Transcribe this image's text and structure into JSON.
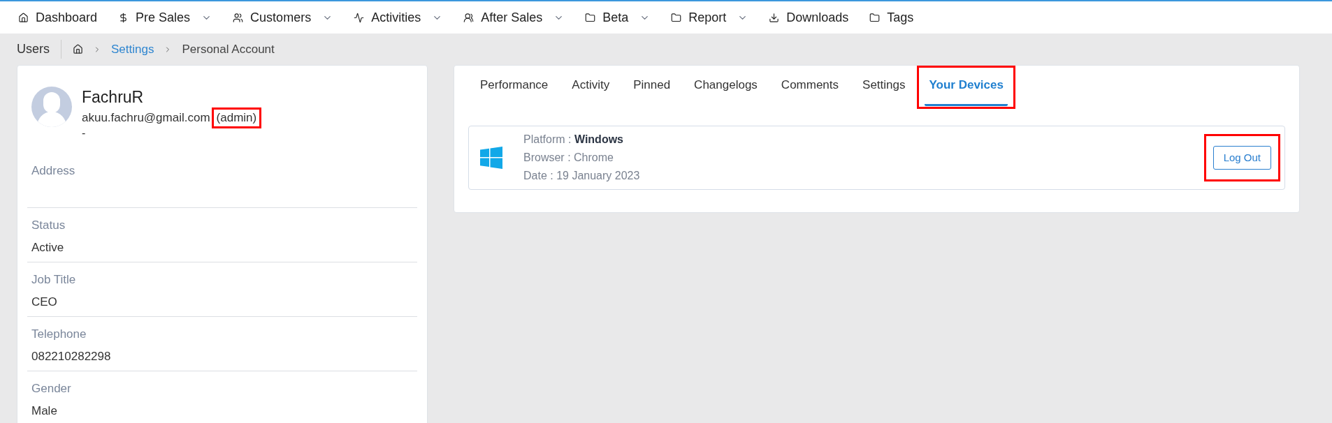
{
  "nav": [
    {
      "label": "Dashboard",
      "dropdown": false
    },
    {
      "label": "Pre Sales",
      "dropdown": true
    },
    {
      "label": "Customers",
      "dropdown": true
    },
    {
      "label": "Activities",
      "dropdown": true
    },
    {
      "label": "After Sales",
      "dropdown": true
    },
    {
      "label": "Beta",
      "dropdown": true
    },
    {
      "label": "Report",
      "dropdown": true
    },
    {
      "label": "Downloads",
      "dropdown": false
    },
    {
      "label": "Tags",
      "dropdown": false
    }
  ],
  "breadcrumb": {
    "title": "Users",
    "items": [
      "Settings",
      "Personal Account"
    ]
  },
  "profile": {
    "name": "FachruR",
    "email": "akuu.fachru@gmail.com",
    "role": "(admin)",
    "role_highlighted": true,
    "note": "-",
    "fields": [
      {
        "label": "Address"
      },
      {
        "label": "Status",
        "value": "Active"
      },
      {
        "label": "Job Title",
        "value": "CEO"
      },
      {
        "label": "Telephone",
        "value": "082210282298"
      },
      {
        "label": "Gender",
        "value": "Male"
      }
    ]
  },
  "tabs": [
    {
      "label": "Performance",
      "selected": false,
      "highlighted": false
    },
    {
      "label": "Activity",
      "selected": false,
      "highlighted": false
    },
    {
      "label": "Pinned",
      "selected": false,
      "highlighted": false
    },
    {
      "label": "Changelogs",
      "selected": false,
      "highlighted": false
    },
    {
      "label": "Comments",
      "selected": false,
      "highlighted": false
    },
    {
      "label": "Settings",
      "selected": false,
      "highlighted": false
    },
    {
      "label": "Your Devices",
      "selected": true,
      "highlighted": true
    }
  ],
  "devices": [
    {
      "platform_label": "Platform :",
      "platform": "Windows",
      "browser": "Browser : Chrome",
      "date": "Date : 19 January 2023",
      "button": "Log Out",
      "button_highlighted": true
    }
  ]
}
